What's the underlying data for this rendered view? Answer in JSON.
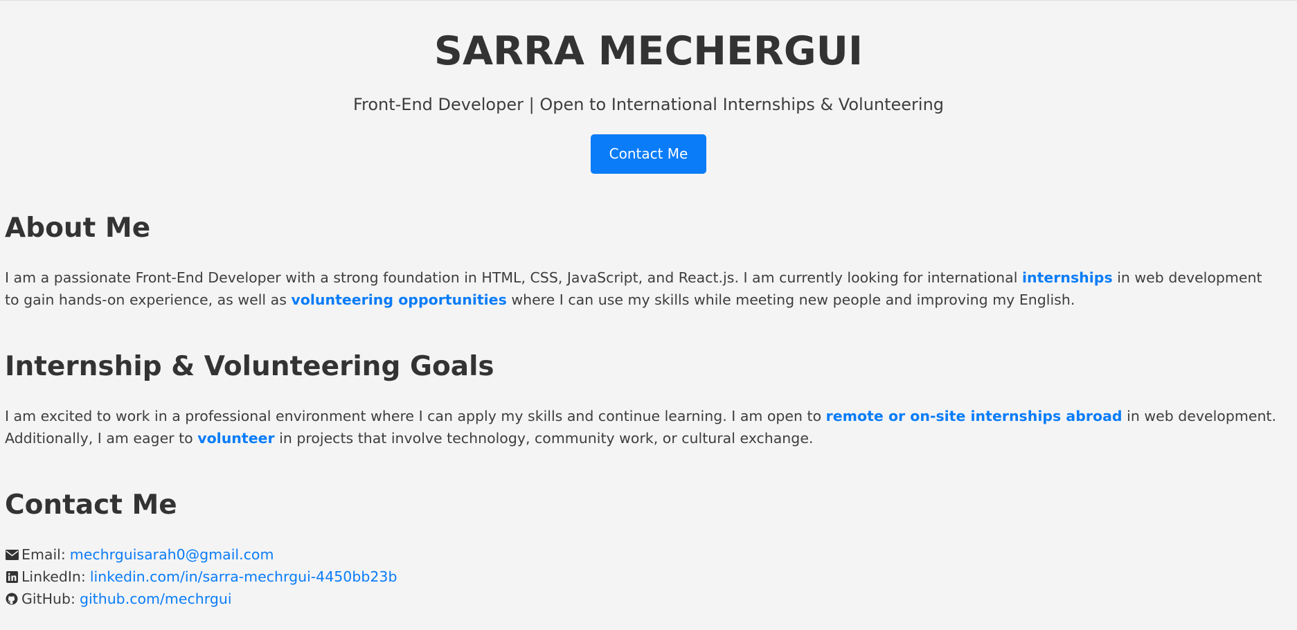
{
  "header": {
    "name": "SARRA MECHERGUI",
    "subtitle": "Front-End Developer | Open to International Internships & Volunteering",
    "cta_label": "Contact Me"
  },
  "about": {
    "title": "About Me",
    "text1": "I am a passionate Front-End Developer with a strong foundation in HTML, CSS, JavaScript, and React.js. I am currently looking for international ",
    "hl1": "internships",
    "text2": " in web development to gain hands-on experience, as well as ",
    "hl2": "volunteering opportunities",
    "text3": " where I can use my skills while meeting new people and improving my English."
  },
  "goals": {
    "title": "Internship & Volunteering Goals",
    "text1": "I am excited to work in a professional environment where I can apply my skills and continue learning. I am open to ",
    "hl1": "remote or on-site internships abroad",
    "text2": " in web development. Additionally, I am eager to ",
    "hl2": "volunteer",
    "text3": " in projects that involve technology, community work, or cultural exchange."
  },
  "contact": {
    "title": "Contact Me",
    "items": [
      {
        "icon": "envelope-icon",
        "label": "Email:",
        "value": "mechrguisarah0@gmail.com"
      },
      {
        "icon": "linkedin-icon",
        "label": "LinkedIn:",
        "value": "linkedin.com/in/sarra-mechrgui-4450bb23b"
      },
      {
        "icon": "github-icon",
        "label": "GitHub:",
        "value": "github.com/mechrgui"
      }
    ]
  },
  "colors": {
    "background": "#f4f4f4",
    "text": "#333333",
    "accent": "#0a7cf7"
  }
}
